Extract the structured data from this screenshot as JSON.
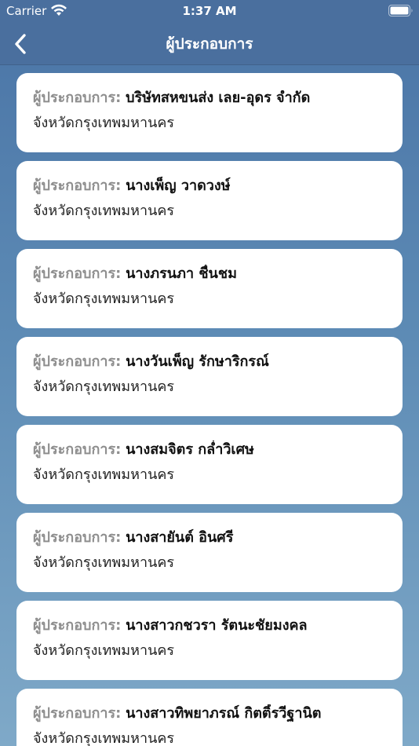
{
  "status_bar": {
    "carrier": "Carrier",
    "time": "1:37 AM",
    "icons": [
      "wifi-icon",
      "battery-icon"
    ]
  },
  "nav": {
    "title": "ผู้ประกอบการ",
    "back_icon": "chevron-left-icon"
  },
  "colors": {
    "nav_background": "#4a6f9e",
    "background_top": "#4a74a6",
    "background_bottom": "#7fa9c8",
    "card": "#ffffff",
    "label_grey": "#8e8e8e"
  },
  "operators": [
    {
      "label": "ผู้ประกอบการ:",
      "name": "บริษัทสหขนส่ง เลย-อุดร จำกัด",
      "province": "จังหวัดกรุงเทพมหานคร"
    },
    {
      "label": "ผู้ประกอบการ:",
      "name": "นางเพ็ญ วาดวงษ์",
      "province": "จังหวัดกรุงเทพมหานคร"
    },
    {
      "label": "ผู้ประกอบการ:",
      "name": "นางภรนภา ชื่นชม",
      "province": "จังหวัดกรุงเทพมหานคร"
    },
    {
      "label": "ผู้ประกอบการ:",
      "name": "นางวันเพ็ญ รักษาริกรณ์",
      "province": "จังหวัดกรุงเทพมหานคร"
    },
    {
      "label": "ผู้ประกอบการ:",
      "name": "นางสมจิตร กล่ำวิเศษ",
      "province": "จังหวัดกรุงเทพมหานคร"
    },
    {
      "label": "ผู้ประกอบการ:",
      "name": "นางสายันต์ อินศรี",
      "province": "จังหวัดกรุงเทพมหานคร"
    },
    {
      "label": "ผู้ประกอบการ:",
      "name": "นางสาวกชวรา รัตนะชัยมงคล",
      "province": "จังหวัดกรุงเทพมหานคร"
    },
    {
      "label": "ผู้ประกอบการ:",
      "name": "นางสาวทิพยาภรณ์ กิตติ์รวีฐานิต",
      "province": "จังหวัดกรุงเทพมหานคร"
    }
  ]
}
